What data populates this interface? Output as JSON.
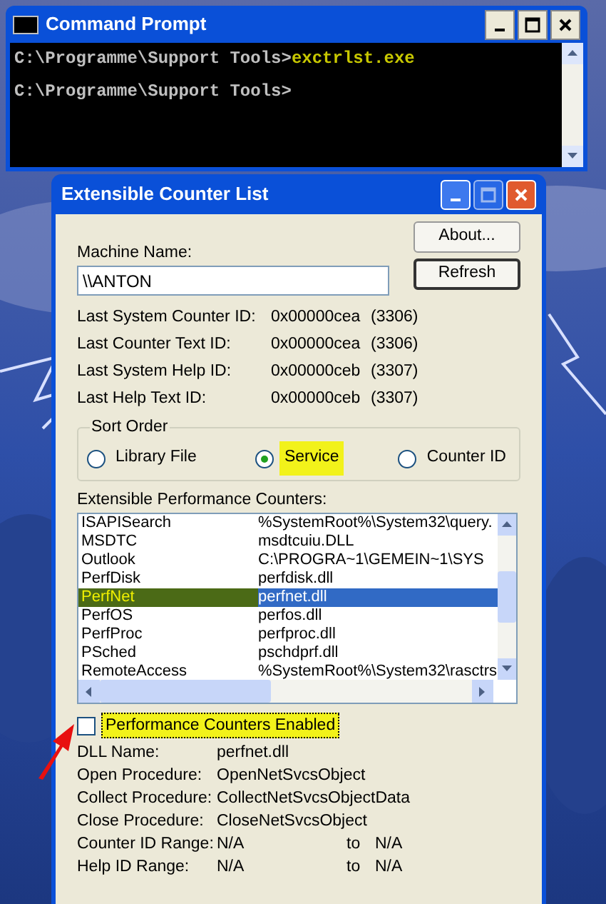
{
  "console_window": {
    "title": "Command Prompt",
    "lines": [
      {
        "prompt": "C:\\Programme\\Support Tools>",
        "command": "exctrlst.exe"
      },
      {
        "prompt": "C:\\Programme\\Support Tools>"
      }
    ]
  },
  "dialog": {
    "title": "Extensible Counter List",
    "machine_name": {
      "label": "Machine Name:",
      "value": "\\\\ANTON"
    },
    "buttons": [
      {
        "label": "About...",
        "default": false
      },
      {
        "label": "Refresh",
        "default": true
      }
    ],
    "info": [
      {
        "label": "Last System Counter ID:",
        "hex": "0x00000cea",
        "decimal": "(3306)"
      },
      {
        "label": "Last Counter Text ID:",
        "hex": "0x00000cea",
        "decimal": "(3306)"
      },
      {
        "label": "Last System Help ID:",
        "hex": "0x00000ceb",
        "decimal": "(3307)"
      },
      {
        "label": "Last Help Text ID:",
        "hex": "0x00000ceb",
        "decimal": "(3307)"
      }
    ],
    "sort_order": {
      "label": "Sort Order",
      "options": [
        {
          "label": "Library File",
          "selected": false,
          "highlighted": false
        },
        {
          "label": "Service",
          "selected": true,
          "highlighted": true
        },
        {
          "label": "Counter ID",
          "selected": false,
          "highlighted": false
        }
      ]
    },
    "counters": {
      "label": "Extensible Performance Counters:",
      "rows": [
        {
          "service": "ISAPISearch",
          "library": "%SystemRoot%\\System32\\query.",
          "selected": false,
          "highlighted": false
        },
        {
          "service": "MSDTC",
          "library": "msdtcuiu.DLL",
          "selected": false,
          "highlighted": false
        },
        {
          "service": "Outlook",
          "library": "C:\\PROGRA~1\\GEMEIN~1\\SYS",
          "selected": false,
          "highlighted": false
        },
        {
          "service": "PerfDisk",
          "library": "perfdisk.dll",
          "selected": false,
          "highlighted": false
        },
        {
          "service": "PerfNet",
          "library": "perfnet.dll",
          "selected": true,
          "highlighted": true
        },
        {
          "service": "PerfOS",
          "library": "perfos.dll",
          "selected": false,
          "highlighted": false
        },
        {
          "service": "PerfProc",
          "library": "perfproc.dll",
          "selected": false,
          "highlighted": false
        },
        {
          "service": "PSched",
          "library": "pschdprf.dll",
          "selected": false,
          "highlighted": false
        },
        {
          "service": "RemoteAccess",
          "library": "%SystemRoot%\\System32\\rasctrs",
          "selected": false,
          "highlighted": false
        }
      ]
    },
    "enabled_checkbox": {
      "label": "Performance Counters Enabled",
      "checked": false,
      "highlighted": true
    },
    "details": [
      {
        "label": "DLL Name:",
        "value": "perfnet.dll"
      },
      {
        "label": "Open Procedure:",
        "value": "OpenNetSvcsObject"
      },
      {
        "label": "Collect Procedure:",
        "value": "CollectNetSvcsObjectData"
      },
      {
        "label": "Close Procedure:",
        "value": "CloseNetSvcsObject"
      },
      {
        "label": "Counter ID Range:",
        "value": "N/A",
        "to": "to",
        "value_2": "N/A"
      },
      {
        "label": "Help ID Range:",
        "value": "N/A",
        "to": "to",
        "value_2": "N/A"
      }
    ]
  }
}
